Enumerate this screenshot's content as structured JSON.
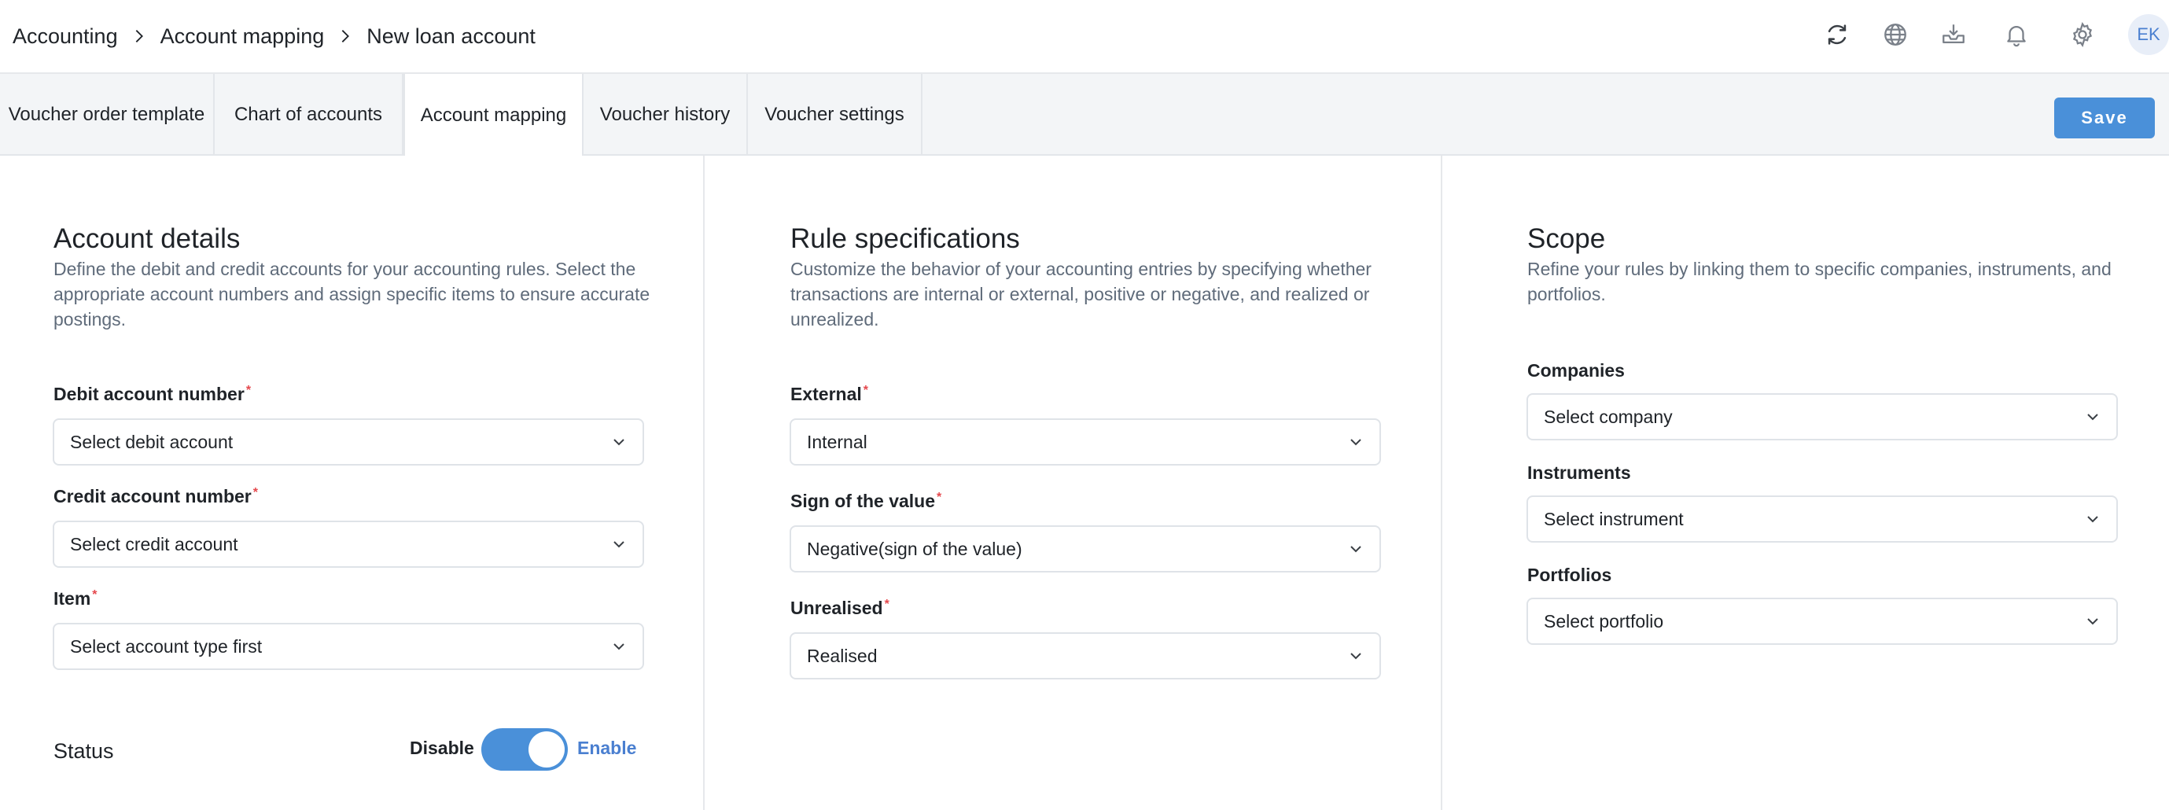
{
  "breadcrumb": {
    "items": [
      "Accounting",
      "Account mapping",
      "New loan account"
    ]
  },
  "header": {
    "icons": [
      "refresh-icon",
      "globe-icon",
      "inbox-download-icon",
      "bell-icon",
      "gear-icon"
    ],
    "avatar_initials": "EK"
  },
  "tabs": [
    {
      "label": "Voucher order template",
      "active": false
    },
    {
      "label": "Chart of accounts",
      "active": false
    },
    {
      "label": "Account mapping",
      "active": true
    },
    {
      "label": "Voucher history",
      "active": false
    },
    {
      "label": "Voucher settings",
      "active": false
    }
  ],
  "toolbar": {
    "save_label": "Save"
  },
  "account_details": {
    "title": "Account details",
    "description": "Define the debit and credit accounts for your accounting rules. Select the appropriate account numbers and assign specific items to ensure accurate postings.",
    "debit": {
      "label": "Debit account number",
      "value": "Select debit account"
    },
    "credit": {
      "label": "Credit account number",
      "value": "Select credit account"
    },
    "item": {
      "label": "Item",
      "value": "Select account type first"
    },
    "status": {
      "label": "Status",
      "off_label": "Disable",
      "on_label": "Enable",
      "enabled": true
    }
  },
  "rule_specifications": {
    "title": "Rule specifications",
    "description": "Customize the behavior of your accounting entries by specifying whether transactions are internal or external, positive or negative, and realized or unrealized.",
    "external": {
      "label": "External",
      "value": "Internal"
    },
    "sign": {
      "label": "Sign of the value",
      "value": "Negative(sign of the value)"
    },
    "unrealised": {
      "label": "Unrealised",
      "value": "Realised"
    }
  },
  "scope": {
    "title": "Scope",
    "description": "Refine your rules by linking them to specific companies, instruments, and portfolios.",
    "companies": {
      "label": "Companies",
      "value": "Select company"
    },
    "instruments": {
      "label": "Instruments",
      "value": "Select instrument"
    },
    "portfolios": {
      "label": "Portfolios",
      "value": "Select portfolio"
    }
  },
  "colors": {
    "accent": "#4a90d9",
    "required": "#e5484d",
    "link": "#4a7fd0"
  }
}
